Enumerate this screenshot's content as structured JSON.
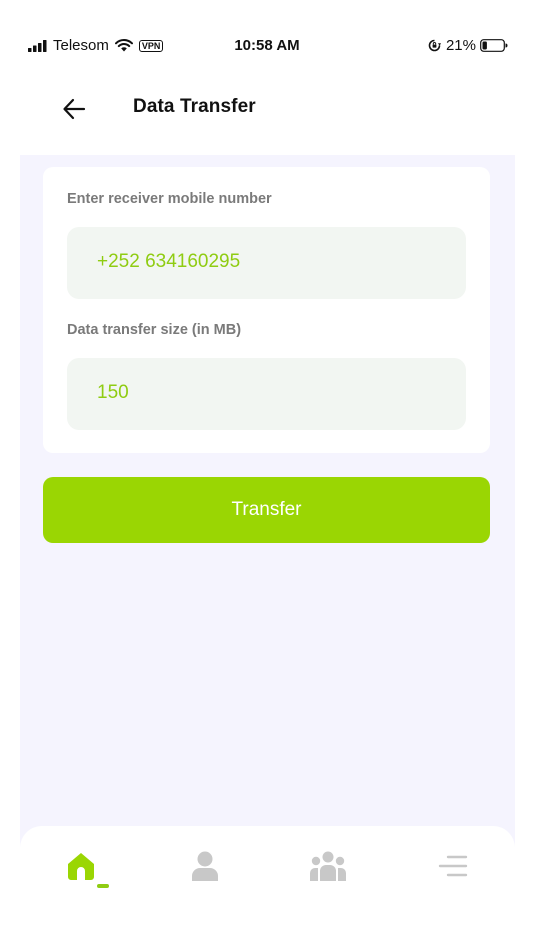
{
  "status_bar": {
    "carrier": "Telesom",
    "vpn": "VPN",
    "time": "10:58 AM",
    "battery_percent": "21%",
    "battery_level": 0.21
  },
  "header": {
    "title": "Data Transfer",
    "back_icon": "arrow-left-icon"
  },
  "form": {
    "receiver_label": "Enter receiver mobile number",
    "receiver_value": "+252 634160295",
    "size_label": "Data transfer size (in MB)",
    "size_value": "150"
  },
  "transfer_button": {
    "label": "Transfer"
  },
  "bottom_nav": {
    "items": [
      {
        "icon": "home-icon",
        "active": true
      },
      {
        "icon": "person-icon",
        "active": false
      },
      {
        "icon": "group-icon",
        "active": false
      },
      {
        "icon": "menu-icon",
        "active": false
      }
    ]
  },
  "colors": {
    "accent": "#9ad603",
    "accent_text": "#8fcc12",
    "background": "#f5f4fe",
    "input_bg": "#f2f6f2",
    "inactive_icon": "#c8c8c8"
  }
}
